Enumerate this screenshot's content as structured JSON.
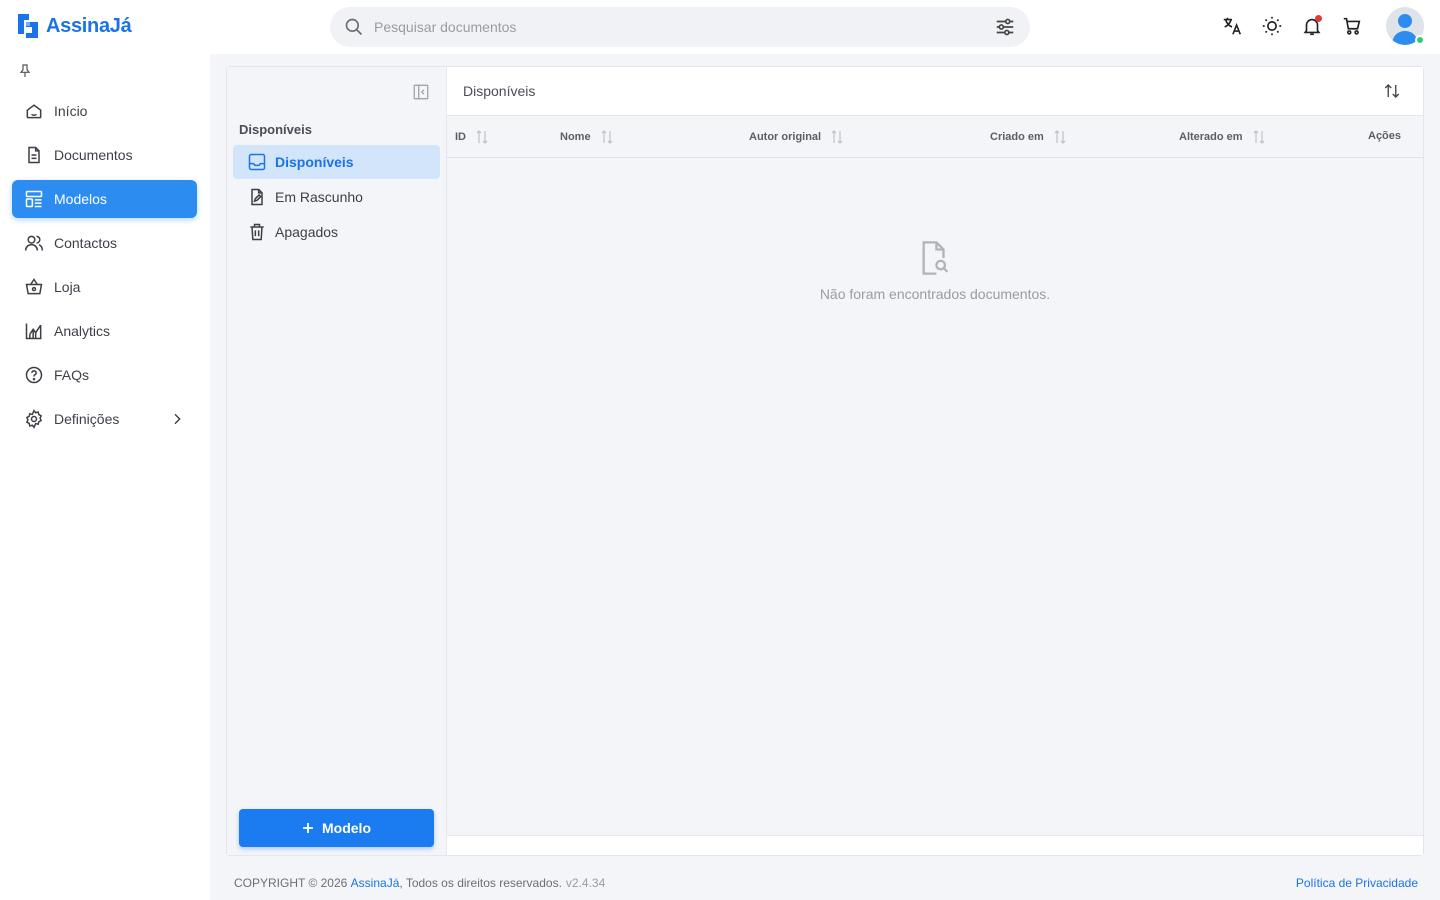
{
  "app": {
    "name": "AssinaJá",
    "brand_color": "#1a73e8"
  },
  "search": {
    "placeholder": "Pesquisar documentos"
  },
  "topbar": {
    "icons": [
      "translate-icon",
      "theme-sun-icon",
      "bell-icon",
      "cart-icon"
    ],
    "notification_dot_color": "#e53935"
  },
  "sidebar": {
    "items": [
      {
        "label": "Início",
        "icon": "home-icon"
      },
      {
        "label": "Documentos",
        "icon": "document-icon"
      },
      {
        "label": "Modelos",
        "icon": "templates-icon",
        "active": true
      },
      {
        "label": "Contactos",
        "icon": "contacts-icon"
      },
      {
        "label": "Loja",
        "icon": "basket-icon"
      },
      {
        "label": "Analytics",
        "icon": "chart-icon"
      },
      {
        "label": "FAQs",
        "icon": "help-icon"
      },
      {
        "label": "Definições",
        "icon": "gear-icon",
        "has_submenu": true
      }
    ],
    "active_color": "#2d8cf0"
  },
  "subnav": {
    "title": "Disponíveis",
    "items": [
      {
        "label": "Disponíveis",
        "icon": "inbox-icon",
        "active": true
      },
      {
        "label": "Em Rascunho",
        "icon": "draft-icon"
      },
      {
        "label": "Apagados",
        "icon": "trash-icon"
      }
    ],
    "add_button_label": "Modelo"
  },
  "content": {
    "title": "Disponíveis",
    "columns": [
      "ID",
      "Nome",
      "Autor original",
      "Criado em",
      "Alterado em",
      "Ações"
    ],
    "empty_message": "Não foram encontrados documentos."
  },
  "footer": {
    "copyright": "COPYRIGHT © 2026",
    "brand": "AssinaJá",
    "rights": ", Todos os direitos reservados.",
    "version": "v2.4.34",
    "policy": "Política de Privacidade"
  }
}
